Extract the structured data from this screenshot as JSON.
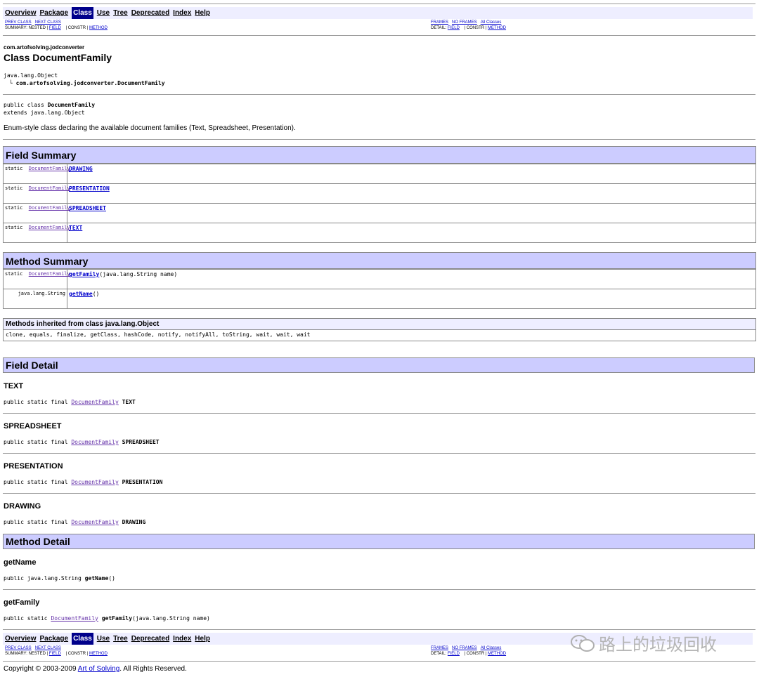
{
  "nav": {
    "items": [
      "Overview",
      "Package",
      "Class",
      "Use",
      "Tree",
      "Deprecated",
      "Index",
      "Help"
    ],
    "current": "Class",
    "prev_class": "PREV CLASS",
    "next_class": "NEXT CLASS",
    "frames": "FRAMES",
    "no_frames": "NO FRAMES",
    "all_classes": "All Classes",
    "summary_prefix": "SUMMARY: NESTED | ",
    "summary_field": "FIELD",
    "summary_constr": " | CONSTR | ",
    "summary_method": "METHOD",
    "detail_prefix": "DETAIL: ",
    "detail_field": "FIELD",
    "detail_constr": " | CONSTR | ",
    "detail_method": "METHOD"
  },
  "header": {
    "package": "com.artofsolving.jodconverter",
    "title": "Class DocumentFamily",
    "hierarchy_root": "java.lang.Object",
    "hierarchy_branch": "└",
    "hierarchy_child": "com.artofsolving.jodconverter.DocumentFamily",
    "decl_prefix": "public class ",
    "decl_name": "DocumentFamily",
    "decl_extends": "extends java.lang.Object",
    "description": "Enum-style class declaring the available document families (Text, Spreadsheet, Presentation)."
  },
  "field_summary": {
    "title": "Field Summary",
    "rows": [
      {
        "modifier": "static",
        "type": "DocumentFamily",
        "name": "DRAWING"
      },
      {
        "modifier": "static",
        "type": "DocumentFamily",
        "name": "PRESENTATION"
      },
      {
        "modifier": "static",
        "type": "DocumentFamily",
        "name": "SPREADSHEET"
      },
      {
        "modifier": "static",
        "type": "DocumentFamily",
        "name": "TEXT"
      }
    ]
  },
  "method_summary": {
    "title": "Method Summary",
    "rows": [
      {
        "modifier": "static",
        "type": "DocumentFamily",
        "name": "getFamily",
        "params": "(java.lang.String  name)"
      },
      {
        "modifier": "",
        "type": "java.lang.String",
        "name": "getName",
        "params": "()"
      }
    ]
  },
  "inherited": {
    "title": "Methods inherited from class java.lang.Object",
    "methods": "clone, equals, finalize, getClass, hashCode, notify, notifyAll, toString, wait, wait, wait"
  },
  "field_detail": {
    "title": "Field Detail",
    "items": [
      {
        "name": "TEXT",
        "prefix": "public static final ",
        "type": "DocumentFamily",
        "ident": "TEXT"
      },
      {
        "name": "SPREADSHEET",
        "prefix": "public static final ",
        "type": "DocumentFamily",
        "ident": "SPREADSHEET"
      },
      {
        "name": "PRESENTATION",
        "prefix": "public static final ",
        "type": "DocumentFamily",
        "ident": "PRESENTATION"
      },
      {
        "name": "DRAWING",
        "prefix": "public static final ",
        "type": "DocumentFamily",
        "ident": "DRAWING"
      }
    ]
  },
  "method_detail": {
    "title": "Method Detail",
    "items": [
      {
        "name": "getName",
        "prefix": "public java.lang.String ",
        "type": "",
        "ident": "getName",
        "params": "()"
      },
      {
        "name": "getFamily",
        "prefix": "public static ",
        "type": "DocumentFamily",
        "ident": "getFamily",
        "params": "(java.lang.String  name)"
      }
    ]
  },
  "footer": {
    "copyright_prefix": "Copyright © 2003-2009 ",
    "copyright_link": "Art of Solving",
    "copyright_suffix": ". All Rights Reserved."
  },
  "watermark": {
    "text": "路上的垃圾回收"
  },
  "colors": {
    "header_bg": "#ccccff",
    "navbar_bg": "#eeeeff",
    "current_nav_bg": "#00008b",
    "link": "#0000cc",
    "visited_link": "#6633aa"
  }
}
